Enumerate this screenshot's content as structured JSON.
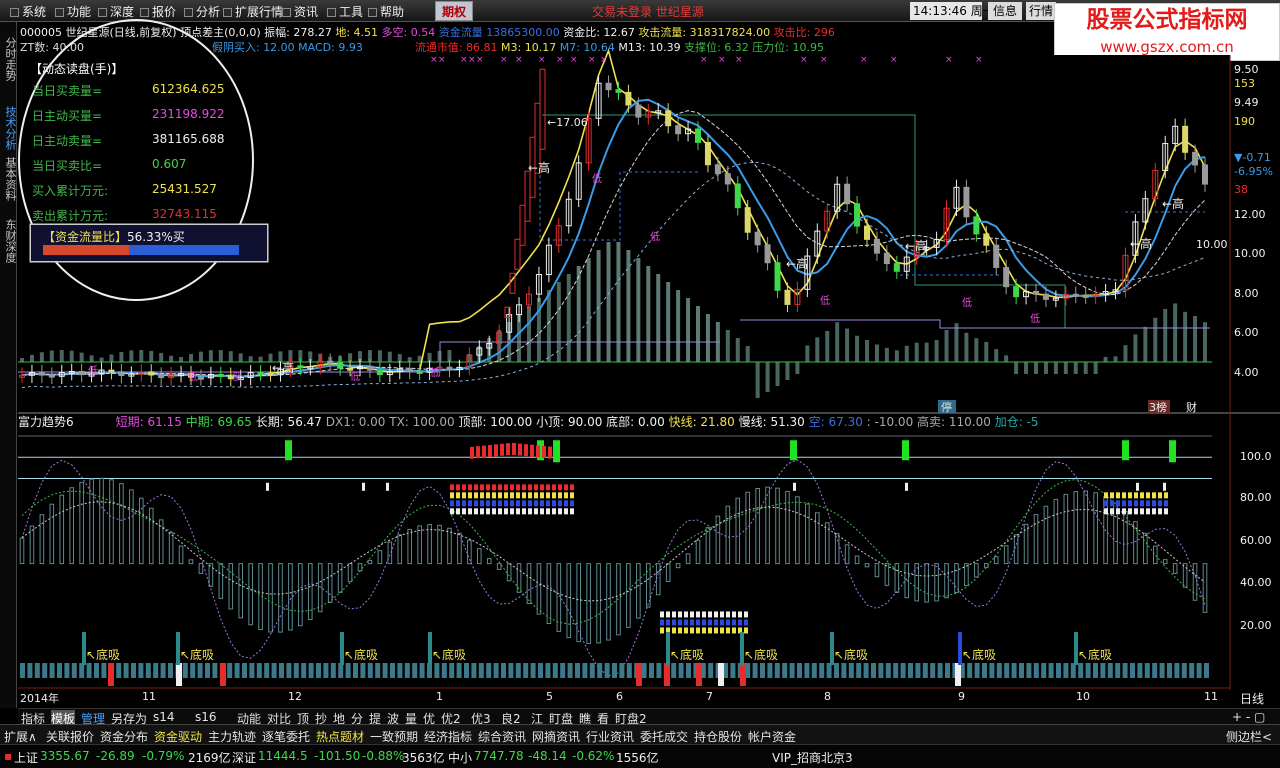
{
  "menubar": {
    "items": [
      "系统",
      "功能",
      "深度",
      "报价",
      "分析",
      "扩展行情",
      "资讯",
      "工具",
      "帮助"
    ],
    "active_tab": "期权",
    "trade_warning": "交易未登录  世纪星源",
    "clock": "14:13:46",
    "weekday": "周一",
    "btn_info": "信息",
    "btn_quote": "行情"
  },
  "logo": {
    "line1": "股票公式指标网",
    "line2": "www.gszx.com.cn"
  },
  "sidebar": {
    "tabs": [
      "分时走势",
      "技术分析",
      "基本资料",
      "东财深度"
    ]
  },
  "header": {
    "row1": [
      {
        "t": "000005 世纪星源(日线,前复权) 顶点差主(0,0,0) ",
        "c": "#f0f0f0"
      },
      {
        "t": "振幅: 278.27 ",
        "c": "#f0f0f0"
      },
      {
        "t": "地: 4.51 ",
        "c": "#f0e24a"
      },
      {
        "t": "多空: 0.54 ",
        "c": "#e64cdf"
      },
      {
        "t": "资金流量 13865300.00 ",
        "c": "#3a6fe0"
      },
      {
        "t": "资金比: 12.67 ",
        "c": "#f0f0f0"
      },
      {
        "t": "攻击流量: 318317824.00 ",
        "c": "#f0e24a"
      },
      {
        "t": "攻击比: 296",
        "c": "#ee2a2a"
      }
    ],
    "row2": [
      {
        "t": "ZT数: 40.00",
        "c": "#dddddd"
      },
      {
        "t": "假阴买入: 12.00 ",
        "c": "#3a9be8"
      },
      {
        "t": "MACD: 9.93",
        "c": "#3a9be8"
      },
      {
        "t": "流通市值: 86.81 ",
        "c": "#ee2a2a"
      },
      {
        "t": "M3: 10.17 ",
        "c": "#f0e24a"
      },
      {
        "t": "M7: 10.64 ",
        "c": "#3a9be8"
      },
      {
        "t": "M13: 10.39 ",
        "c": "#f0f0f0"
      },
      {
        "t": "支撑位: 6.32 ",
        "c": "#3fb84a"
      },
      {
        "t": "压力位: 10.95",
        "c": "#3fb84a"
      }
    ]
  },
  "dynamic": {
    "title": "【动态读盘(手)】",
    "items": [
      {
        "label": "当日买卖量=",
        "value": "612364.625",
        "color": "#f0e24a"
      },
      {
        "label": "日主动买量=",
        "value": "231198.922",
        "color": "#e64cdf"
      },
      {
        "label": "日主动卖量=",
        "value": "381165.688",
        "color": "#f0f0f0"
      },
      {
        "label": "当日买卖比=",
        "value": "0.607",
        "color": "#3fd84a"
      },
      {
        "label": "买入累计万元:",
        "value": "25431.527",
        "color": "#f0e24a"
      },
      {
        "label": "卖出累计万元:",
        "value": "32743.115",
        "color": "#ee2a2a"
      }
    ],
    "flow_label": "【资金流量比】",
    "flow_value": "56.33%买"
  },
  "main_yaxis": [
    {
      "v": "9.50",
      "c": "#f0f0f0"
    },
    {
      "v": "153",
      "c": "#f0e24a"
    },
    {
      "v": "9.49",
      "c": "#f0f0f0"
    },
    {
      "v": "190",
      "c": "#f0e24a"
    },
    {
      "v": "▼-0.71",
      "c": "#3a9be8"
    },
    {
      "v": "-6.95%",
      "c": "#3a9be8"
    },
    {
      "v": "38",
      "c": "#ee2a2a"
    },
    {
      "v": "12.00",
      "c": "#f0f0f0"
    },
    {
      "v": "10.00",
      "c": "#f0f0f0"
    },
    {
      "v": "8.00",
      "c": "#f0f0f0"
    },
    {
      "v": "6.00",
      "c": "#f0f0f0"
    },
    {
      "v": "4.00",
      "c": "#f0f0f0"
    }
  ],
  "chart_annotations": {
    "peak": "17.06",
    "high": "高",
    "low": "低",
    "price_right": "10.00",
    "stop": "停",
    "rank": "3榜",
    "fin": "财",
    "dibuxi": "底吸"
  },
  "indicator2": {
    "name": "富力趋势6",
    "parts": [
      {
        "t": "短期: 61.15 ",
        "c": "#e64cdf"
      },
      {
        "t": "中期: 69.65 ",
        "c": "#3fd84a"
      },
      {
        "t": "长期: 56.47 ",
        "c": "#f0f0f0"
      },
      {
        "t": "DX1: 0.00 ",
        "c": "#aaaaaa"
      },
      {
        "t": "TX: 100.00 ",
        "c": "#aaaaaa"
      },
      {
        "t": "顶部: 100.00 ",
        "c": "#f0f0f0"
      },
      {
        "t": "小顶: 90.00 ",
        "c": "#f0f0f0"
      },
      {
        "t": "底部: 0.00 ",
        "c": "#f0f0f0"
      },
      {
        "t": "快线: 21.80 ",
        "c": "#f0e24a"
      },
      {
        "t": "慢线: 51.30 ",
        "c": "#f0f0f0"
      },
      {
        "t": "空: 67.30 ",
        "c": "#3a6fe0"
      },
      {
        "t": ": -10.00 ",
        "c": "#aaaaaa"
      },
      {
        "t": "高卖: 110.00 ",
        "c": "#aaaaaa"
      },
      {
        "t": "加仓: -5",
        "c": "#22aaaa"
      }
    ],
    "yaxis": [
      "100.0",
      "80.00",
      "60.00",
      "40.00",
      "20.00"
    ]
  },
  "chart_data": {
    "type": "candlestick",
    "title": "",
    "x": [
      "2014年",
      "11",
      "12",
      "1",
      "5",
      "6",
      "7",
      "8",
      "9",
      "10",
      "11"
    ],
    "price_ylim": [
      3,
      14
    ],
    "price_ticks": [
      4,
      6,
      8,
      10,
      12
    ],
    "indicator_ylim": [
      0,
      110
    ],
    "indicator_ticks": [
      20,
      40,
      60,
      80,
      100
    ],
    "last_price": 10.0,
    "peak_price": 17.06,
    "period": "日线"
  },
  "datebar": {
    "labels": [
      "2014年",
      "11",
      "12",
      "1",
      "5",
      "6",
      "7",
      "8",
      "9",
      "10",
      "11"
    ],
    "right": "日线"
  },
  "toolbar": {
    "items": [
      "指标",
      "模板",
      "管理",
      "另存为",
      "s14",
      "s16",
      "动能",
      "对比",
      "顶",
      "抄",
      "地",
      "分",
      "提",
      "波",
      "量",
      "优",
      "优2",
      "优3",
      "良2",
      "江",
      "盯盘",
      "瞧",
      "看",
      "盯盘2"
    ],
    "right": "+ - ▢"
  },
  "newsbar": {
    "items": [
      "扩展∧",
      "关联报价",
      "资金分布",
      "资金驱动",
      "主力轨迹",
      "逐笔委托",
      "热点题材",
      "一致预期",
      "经济指标",
      "综合资讯",
      "网摘资讯",
      "行业资讯",
      "委托成交",
      "持仓股份",
      "帐户资金"
    ],
    "right": "侧边栏<"
  },
  "statusbar": {
    "sh_name": "上证",
    "sh_val": "3355.67",
    "sh_chg": "-26.89",
    "sh_pct": "-0.79%",
    "sh_amt": "2169亿",
    "sz_name": "深证",
    "sz_val": "11444.5",
    "sz_chg": "-101.50",
    "sz_pct": "-0.88%",
    "sz_amt": "3563亿",
    "zx_name": "中小",
    "zx_val": "7747.78",
    "zx_chg": "-48.14",
    "zx_pct": "-0.62%",
    "zx_amt": "1556亿",
    "vip": "VIP_招商北京3"
  }
}
